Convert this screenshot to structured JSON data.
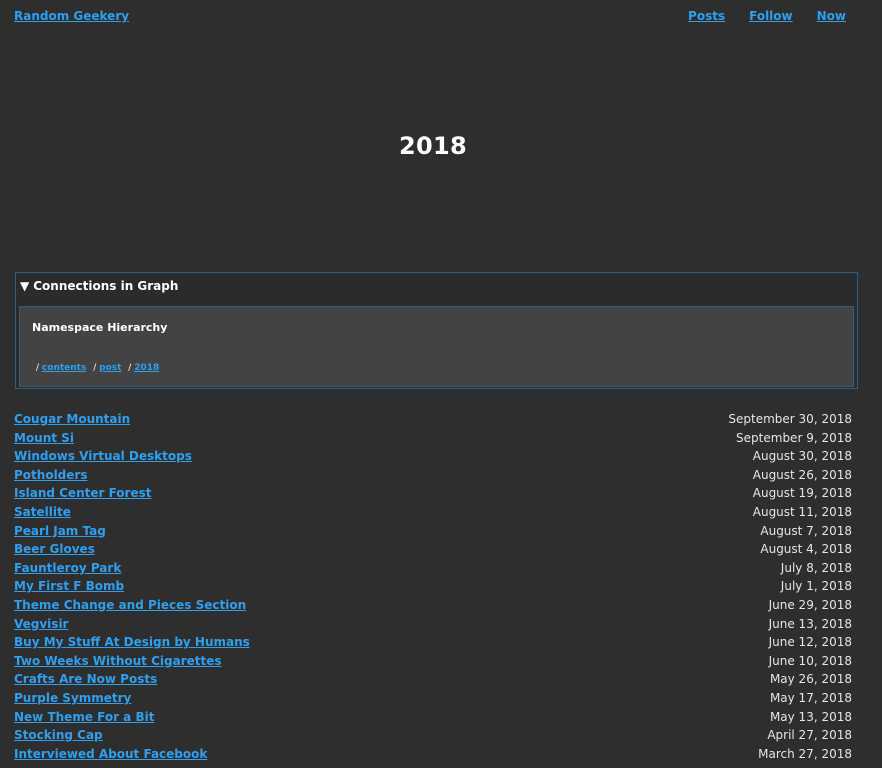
{
  "header": {
    "site_title": "Random Geekery",
    "nav": [
      {
        "label": "Posts"
      },
      {
        "label": "Follow"
      },
      {
        "label": "Now"
      }
    ]
  },
  "page_title": "2018",
  "graph": {
    "toggle_icon": "triangle-down-icon",
    "summary": "Connections in Graph",
    "namespace_title": "Namespace Hierarchy",
    "path": [
      "contents",
      "post",
      "2018"
    ]
  },
  "posts": [
    {
      "title": "Cougar Mountain",
      "date": "September 30, 2018"
    },
    {
      "title": "Mount Si",
      "date": "September 9, 2018"
    },
    {
      "title": "Windows Virtual Desktops",
      "date": "August 30, 2018"
    },
    {
      "title": "Potholders",
      "date": "August 26, 2018"
    },
    {
      "title": "Island Center Forest",
      "date": "August 19, 2018"
    },
    {
      "title": "Satellite",
      "date": "August 11, 2018"
    },
    {
      "title": "Pearl Jam Tag",
      "date": "August 7, 2018"
    },
    {
      "title": "Beer Gloves",
      "date": "August 4, 2018"
    },
    {
      "title": "Fauntleroy Park",
      "date": "July 8, 2018"
    },
    {
      "title": "My First F Bomb",
      "date": "July 1, 2018"
    },
    {
      "title": "Theme Change and Pieces Section",
      "date": "June 29, 2018"
    },
    {
      "title": "Vegvisir",
      "date": "June 13, 2018"
    },
    {
      "title": "Buy My Stuff At Design by Humans",
      "date": "June 12, 2018"
    },
    {
      "title": "Two Weeks Without Cigarettes",
      "date": "June 10, 2018"
    },
    {
      "title": "Crafts Are Now Posts",
      "date": "May 26, 2018"
    },
    {
      "title": "Purple Symmetry",
      "date": "May 17, 2018"
    },
    {
      "title": "New Theme For a Bit",
      "date": "May 13, 2018"
    },
    {
      "title": "Stocking Cap",
      "date": "April 27, 2018"
    },
    {
      "title": "Interviewed About Facebook",
      "date": "March 27, 2018"
    }
  ]
}
